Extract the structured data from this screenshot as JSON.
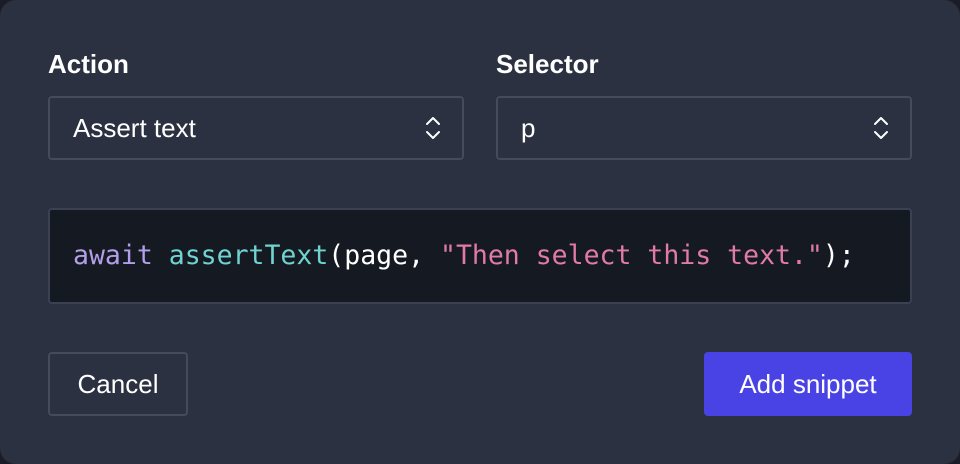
{
  "action": {
    "label": "Action",
    "value": "Assert text"
  },
  "selector": {
    "label": "Selector",
    "value": "p"
  },
  "code": {
    "tokens": [
      {
        "type": "keyword",
        "text": "await"
      },
      {
        "type": "plain",
        "text": " "
      },
      {
        "type": "func",
        "text": "assertText"
      },
      {
        "type": "plain",
        "text": "(page, "
      },
      {
        "type": "string",
        "text": "\"Then select this text.\""
      },
      {
        "type": "plain",
        "text": ");"
      }
    ]
  },
  "buttons": {
    "cancel": "Cancel",
    "add": "Add snippet"
  },
  "icons": {
    "select_arrows": "chevron-up-down-icon"
  },
  "colors": {
    "background": "#2b3140",
    "code_background": "#151922",
    "primary": "#4943e6",
    "keyword": "#b39ee8",
    "function": "#6fd3cf",
    "string": "#e07aa7"
  }
}
